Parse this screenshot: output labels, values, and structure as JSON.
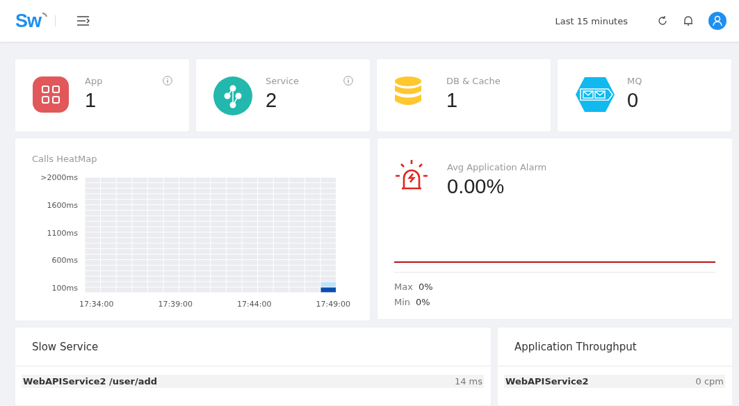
{
  "header": {
    "logo": "Sw",
    "time_range": "Last 15 minutes"
  },
  "stats": [
    {
      "kind": "app",
      "label": "App",
      "value": "1",
      "info": true
    },
    {
      "kind": "service",
      "label": "Service",
      "value": "2",
      "info": true
    },
    {
      "kind": "db",
      "label": "DB & Cache",
      "value": "1",
      "info": false
    },
    {
      "kind": "mq",
      "label": "MQ",
      "value": "0",
      "info": false
    }
  ],
  "heatmap": {
    "title": "Calls HeatMap",
    "y_labels": [
      ">2000ms",
      "1600ms",
      "1100ms",
      "600ms",
      "100ms"
    ],
    "x_labels": [
      "17:34:00",
      "17:39:00",
      "17:44:00",
      "17:49:00"
    ]
  },
  "alarm": {
    "title": "Avg Application Alarm",
    "value": "0.00%",
    "max_label": "Max",
    "max": "0%",
    "min_label": "Min",
    "min": "0%"
  },
  "slow_service": {
    "title": "Slow Service",
    "rows": [
      {
        "name": "WebAPIService2 /user/add",
        "value": "14 ms"
      }
    ]
  },
  "throughput": {
    "title": "Application Throughput",
    "rows": [
      {
        "name": "WebAPIService2",
        "value": "0 cpm"
      }
    ]
  }
}
